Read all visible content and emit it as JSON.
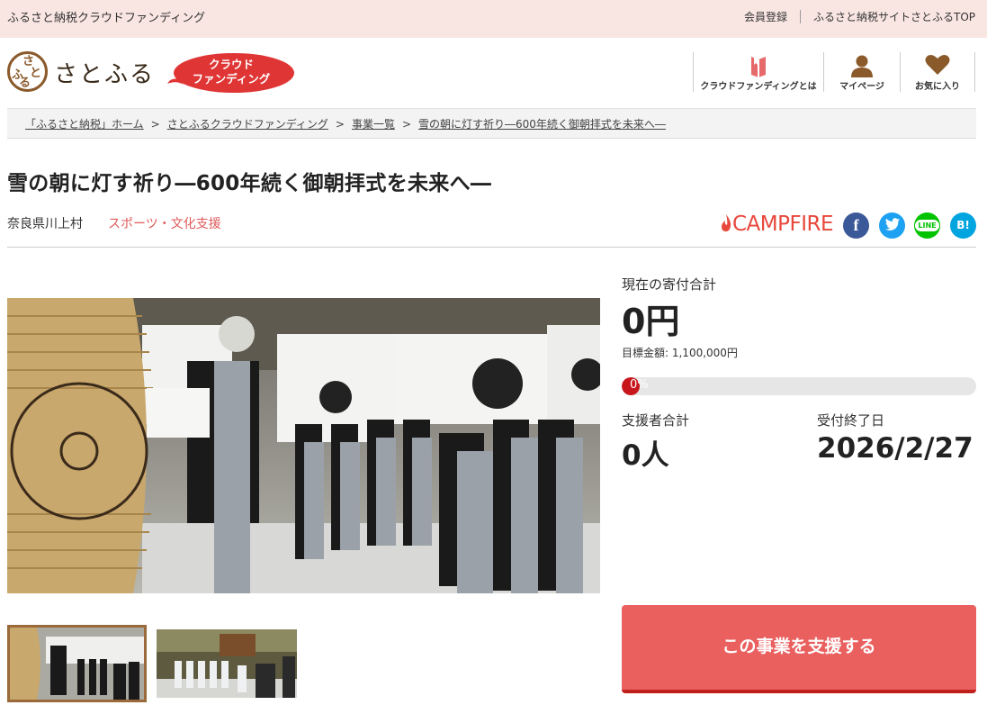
{
  "topbar": {
    "site_name": "ふるさと納税クラウドファンディング",
    "member_register": "会員登録",
    "satofull_top": "ふるさと納税サイトさとふるTOP"
  },
  "header": {
    "logo_chars": [
      "さ",
      "と",
      "ふ",
      "る"
    ],
    "brand": "さとふる",
    "cf_badge_line1": "クラウド",
    "cf_badge_line2": "ファンディング",
    "nav": [
      {
        "label": "クラウドファンディングとは",
        "icon": "book-icon"
      },
      {
        "label": "マイページ",
        "icon": "user-icon"
      },
      {
        "label": "お気に入り",
        "icon": "heart-icon"
      }
    ]
  },
  "breadcrumb": [
    "「ふるさと納税」ホーム",
    "さとふるクラウドファンディング",
    "事業一覧",
    "雪の朝に灯す祈り―600年続く御朝拝式を未来へ―"
  ],
  "breadcrumb_sep": ">",
  "project": {
    "title": "雪の朝に灯す祈り―600年続く御朝拝式を未来へ―",
    "prefecture": "奈良県川上村",
    "category": "スポーツ・文化支援",
    "campfire": "CAMPFIRE",
    "share": [
      {
        "label": "f",
        "icon": "facebook-icon",
        "color": "#3b5998"
      },
      {
        "label": "t",
        "icon": "twitter-icon",
        "color": "#1da1f2"
      },
      {
        "label": "LINE",
        "icon": "line-icon",
        "color": "#00c300"
      },
      {
        "label": "B!",
        "icon": "hatena-icon",
        "color": "#00a4de"
      }
    ]
  },
  "stats": {
    "total_label": "現在の寄付合計",
    "total_value": "0円",
    "goal_text": "目標金額: 1,100,000円",
    "progress_percent": 0,
    "progress_label": "0%",
    "supporters_label": "支援者合計",
    "supporters_value": "0人",
    "deadline_label": "受付終了日",
    "deadline_value": "2026/2/27"
  },
  "cta": {
    "support_label": "この事業を支援する"
  },
  "colors": {
    "topbar_bg": "#f9e6e3",
    "accent_red": "#e9605f",
    "category_red": "#e05a5a",
    "brand_brown": "#8a5a2b"
  }
}
